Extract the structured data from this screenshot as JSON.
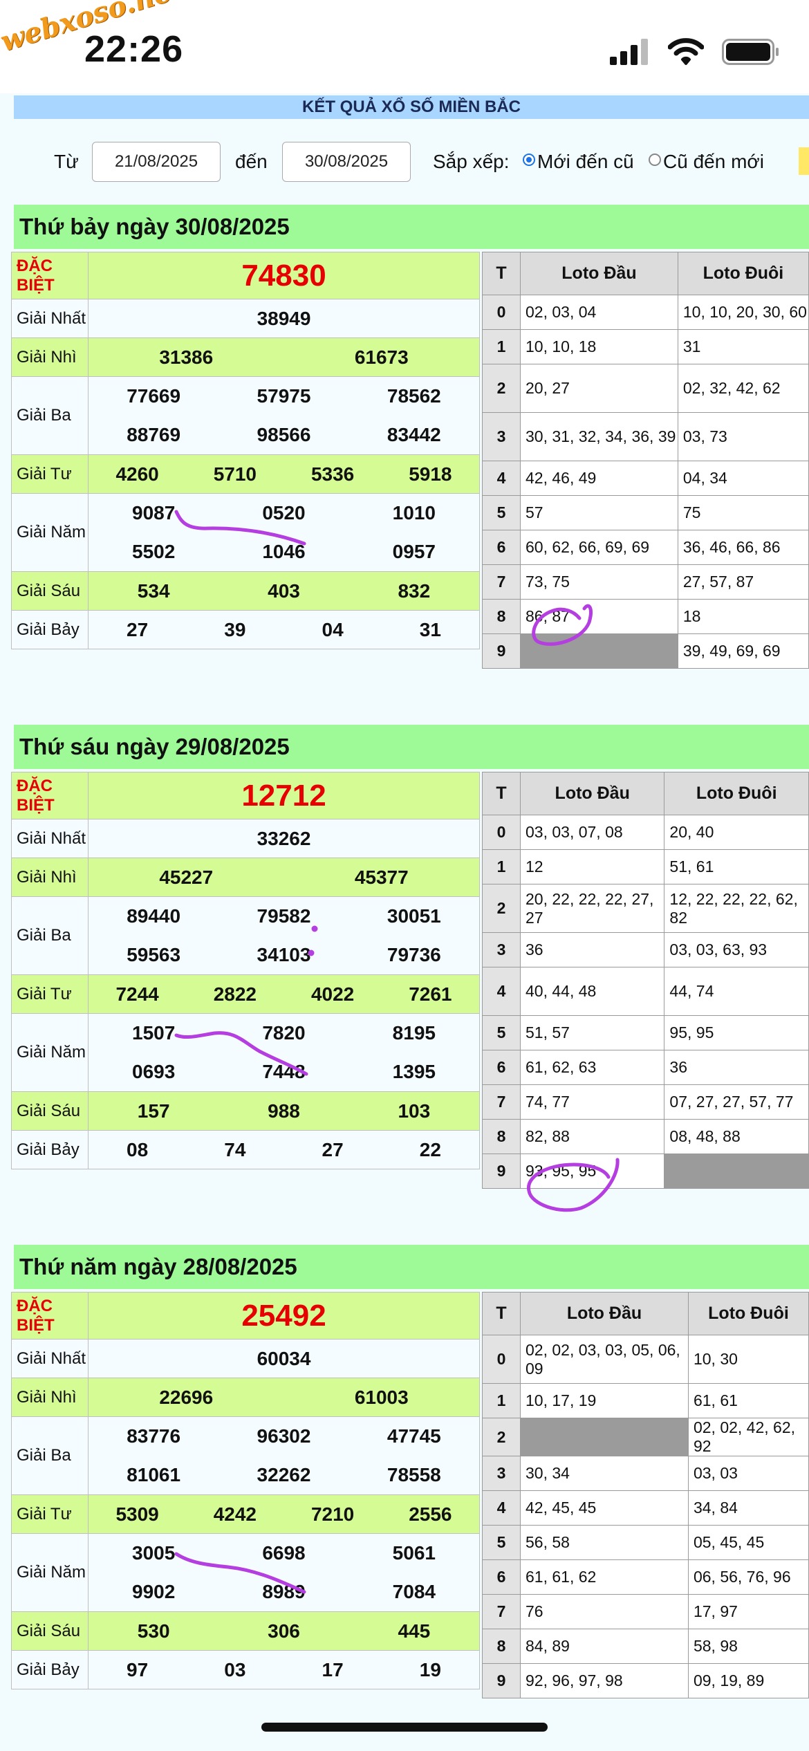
{
  "status": {
    "time": "22:26",
    "watermark": "webxoso.net"
  },
  "banner": "KẾT QUẢ XỔ SỐ MIỀN BẮC",
  "filter": {
    "from_label": "Từ",
    "from_value": "21/08/2025",
    "to_label": "đến",
    "to_value": "30/08/2025",
    "sort_label": "Sắp xếp:",
    "option_new": "Mới đến cũ",
    "option_old": "Cũ đến mới"
  },
  "labels": {
    "dac_biet_1": "ĐẶC",
    "dac_biet_2": "BIỆT",
    "giai_nhat": "Giải Nhất",
    "giai_nhi": "Giải Nhì",
    "giai_ba": "Giải Ba",
    "giai_tu": "Giải Tư",
    "giai_nam": "Giải Năm",
    "giai_sau": "Giải Sáu",
    "giai_bay": "Giải Bảy",
    "col_t": "T",
    "col_dau": "Loto Đầu",
    "col_duoi": "Loto Đuôi"
  },
  "days": [
    {
      "title": "Thứ bảy ngày 30/08/2025",
      "dac_biet": "74830",
      "nhat": "38949",
      "nhi": [
        "31386",
        "61673"
      ],
      "ba": [
        "77669",
        "57975",
        "78562",
        "88769",
        "98566",
        "83442"
      ],
      "tu": [
        "4260",
        "5710",
        "5336",
        "5918"
      ],
      "nam": [
        "9087",
        "0520",
        "1010",
        "5502",
        "1046",
        "0957"
      ],
      "sau": [
        "534",
        "403",
        "832"
      ],
      "bay": [
        "27",
        "39",
        "04",
        "31"
      ],
      "loto": [
        {
          "t": "0",
          "dau": "02, 03, 04",
          "duoi": "10, 10, 20, 30, 60"
        },
        {
          "t": "1",
          "dau": "10, 10, 18",
          "duoi": "31"
        },
        {
          "t": "2",
          "dau": "20, 27",
          "duoi": "02, 32, 42, 62"
        },
        {
          "t": "3",
          "dau": "30, 31, 32, 34, 36, 39",
          "duoi": "03, 73"
        },
        {
          "t": "4",
          "dau": "42, 46, 49",
          "duoi": "04, 34"
        },
        {
          "t": "5",
          "dau": "57",
          "duoi": "75"
        },
        {
          "t": "6",
          "dau": "60, 62, 66, 69, 69",
          "duoi": "36, 46, 66, 86"
        },
        {
          "t": "7",
          "dau": "73, 75",
          "duoi": "27, 57, 87"
        },
        {
          "t": "8",
          "dau": "86, 87",
          "duoi": "18"
        },
        {
          "t": "9",
          "dau": "",
          "duoi": "39, 49, 69, 69"
        }
      ]
    },
    {
      "title": "Thứ sáu ngày 29/08/2025",
      "dac_biet": "12712",
      "nhat": "33262",
      "nhi": [
        "45227",
        "45377"
      ],
      "ba": [
        "89440",
        "79582",
        "30051",
        "59563",
        "34103",
        "79736"
      ],
      "tu": [
        "7244",
        "2822",
        "4022",
        "7261"
      ],
      "nam": [
        "1507",
        "7820",
        "8195",
        "0693",
        "7448",
        "1395"
      ],
      "sau": [
        "157",
        "988",
        "103"
      ],
      "bay": [
        "08",
        "74",
        "27",
        "22"
      ],
      "loto": [
        {
          "t": "0",
          "dau": "03, 03, 07, 08",
          "duoi": "20, 40"
        },
        {
          "t": "1",
          "dau": "12",
          "duoi": "51, 61"
        },
        {
          "t": "2",
          "dau": "20, 22, 22, 22, 27, 27",
          "duoi": "12, 22, 22, 22, 62, 82"
        },
        {
          "t": "3",
          "dau": "36",
          "duoi": "03, 03, 63, 93"
        },
        {
          "t": "4",
          "dau": "40, 44, 48",
          "duoi": "44, 74"
        },
        {
          "t": "5",
          "dau": "51, 57",
          "duoi": "95, 95"
        },
        {
          "t": "6",
          "dau": "61, 62, 63",
          "duoi": "36"
        },
        {
          "t": "7",
          "dau": "74, 77",
          "duoi": "07, 27, 27, 57, 77"
        },
        {
          "t": "8",
          "dau": "82, 88",
          "duoi": "08, 48, 88"
        },
        {
          "t": "9",
          "dau": "93, 95, 95",
          "duoi": ""
        }
      ]
    },
    {
      "title": "Thứ năm ngày 28/08/2025",
      "dac_biet": "25492",
      "nhat": "60034",
      "nhi": [
        "22696",
        "61003"
      ],
      "ba": [
        "83776",
        "96302",
        "47745",
        "81061",
        "32262",
        "78558"
      ],
      "tu": [
        "5309",
        "4242",
        "7210",
        "2556"
      ],
      "nam": [
        "3005",
        "6698",
        "5061",
        "9902",
        "8989",
        "7084"
      ],
      "sau": [
        "530",
        "306",
        "445"
      ],
      "bay": [
        "97",
        "03",
        "17",
        "19"
      ],
      "loto": [
        {
          "t": "0",
          "dau": "02, 02, 03, 03, 05, 06, 09",
          "duoi": "10, 30"
        },
        {
          "t": "1",
          "dau": "10, 17, 19",
          "duoi": "61, 61"
        },
        {
          "t": "2",
          "dau": "",
          "duoi": "02, 02, 42, 62, 92"
        },
        {
          "t": "3",
          "dau": "30, 34",
          "duoi": "03, 03"
        },
        {
          "t": "4",
          "dau": "42, 45, 45",
          "duoi": "34, 84"
        },
        {
          "t": "5",
          "dau": "56, 58",
          "duoi": "05, 45, 45"
        },
        {
          "t": "6",
          "dau": "61, 61, 62",
          "duoi": "06, 56, 76, 96"
        },
        {
          "t": "7",
          "dau": "76",
          "duoi": "17, 97"
        },
        {
          "t": "8",
          "dau": "84, 89",
          "duoi": "58, 98"
        },
        {
          "t": "9",
          "dau": "92, 96, 97, 98",
          "duoi": "09, 19, 89"
        }
      ]
    }
  ]
}
